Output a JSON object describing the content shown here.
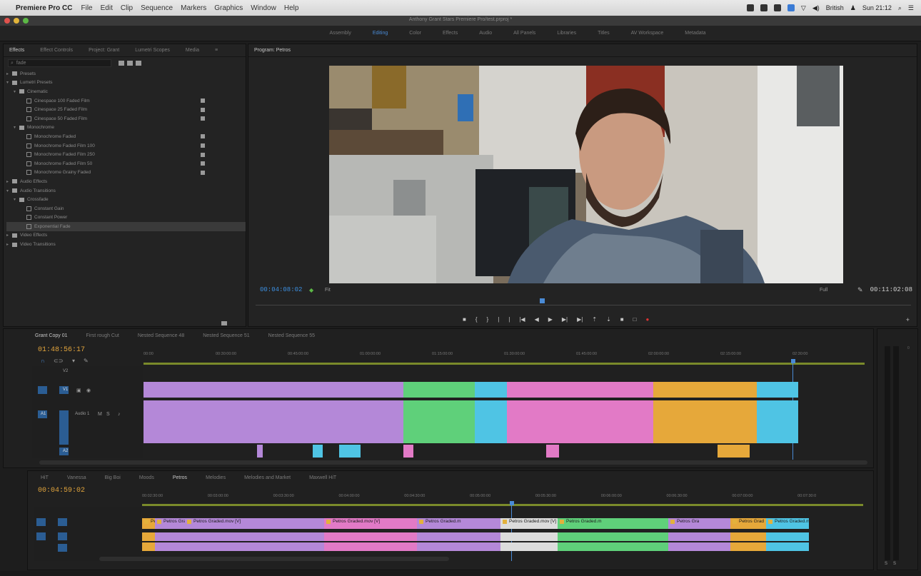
{
  "menubar": {
    "app_name": "Premiere Pro CC",
    "menus": [
      "File",
      "Edit",
      "Clip",
      "Sequence",
      "Markers",
      "Graphics",
      "Window",
      "Help"
    ],
    "language": "British",
    "clock": "Sun 21:12"
  },
  "window": {
    "title": "Anthony Grant Stars Premiere Pro/test.prproj *"
  },
  "workspaces": {
    "items": [
      "Assembly",
      "Editing",
      "Color",
      "Effects",
      "Audio",
      "All Panels",
      "Libraries",
      "Titles",
      "AV Workspace",
      "Metadata"
    ],
    "active": "Editing"
  },
  "effects_panel": {
    "tabs": [
      "Effects",
      "Effect Controls",
      "Project: Grant",
      "Lumetri Scopes",
      "Media"
    ],
    "search_value": "fade",
    "tree": [
      {
        "label": "Presets",
        "level": 0,
        "kind": "folder"
      },
      {
        "label": "Lumetri Presets",
        "level": 0,
        "kind": "folder"
      },
      {
        "label": "Cinematic",
        "level": 1,
        "kind": "folder"
      },
      {
        "label": "Cinespace 100 Faded Film",
        "level": 2,
        "kind": "fx",
        "badge": true
      },
      {
        "label": "Cinespace 25 Faded Film",
        "level": 2,
        "kind": "fx",
        "badge": true
      },
      {
        "label": "Cinespace 50 Faded Film",
        "level": 2,
        "kind": "fx",
        "badge": true
      },
      {
        "label": "Monochrome",
        "level": 1,
        "kind": "folder"
      },
      {
        "label": "Monochrome Faded",
        "level": 2,
        "kind": "fx",
        "badge": true
      },
      {
        "label": "Monochrome Faded Film 100",
        "level": 2,
        "kind": "fx",
        "badge": true
      },
      {
        "label": "Monochrome Faded Film 250",
        "level": 2,
        "kind": "fx",
        "badge": true
      },
      {
        "label": "Monochrome Faded Film 50",
        "level": 2,
        "kind": "fx",
        "badge": true
      },
      {
        "label": "Monochrome Grainy Faded",
        "level": 2,
        "kind": "fx",
        "badge": true
      },
      {
        "label": "Audio Effects",
        "level": 0,
        "kind": "folder"
      },
      {
        "label": "Audio Transitions",
        "level": 0,
        "kind": "folder"
      },
      {
        "label": "Crossfade",
        "level": 1,
        "kind": "folder"
      },
      {
        "label": "Constant Gain",
        "level": 2,
        "kind": "fx"
      },
      {
        "label": "Constant Power",
        "level": 2,
        "kind": "fx"
      },
      {
        "label": "Exponential Fade",
        "level": 2,
        "kind": "fx",
        "selected": true
      },
      {
        "label": "Video Effects",
        "level": 0,
        "kind": "folder"
      },
      {
        "label": "Video Transitions",
        "level": 0,
        "kind": "folder"
      }
    ]
  },
  "program_monitor": {
    "tab": "Program: Petros",
    "current_timecode": "00:04:08:02",
    "zoom": "Fit",
    "resolution": "Full",
    "duration": "00:11:02:08"
  },
  "timeline1": {
    "tabs": [
      "Grant Copy 01",
      "First rough Cut",
      "Nested Sequence 48",
      "Nested Sequence 51",
      "Nested Sequence 55"
    ],
    "timecode": "01:48:56:17",
    "ruler": [
      "00:00",
      "00:30:00:00",
      "00:45:00:00",
      "01:00:00:00",
      "01:15:00:00",
      "01:30:00:00",
      "01:45:00:00",
      "02:00:00:00",
      "02:15:00:00",
      "02:30:00"
    ],
    "tracks": {
      "v2": "V2",
      "v1": "V1",
      "a1": "A1",
      "audio_label": "Audio 1",
      "a2": "A2"
    }
  },
  "timeline2": {
    "tabs": [
      "HiT",
      "Vanessa",
      "Big Boi",
      "Moods",
      "Petros",
      "Melodies",
      "Melodies and Market",
      "Maxwell HiT"
    ],
    "active_tab": "Petros",
    "timecode": "00:04:59:02",
    "ruler": [
      "00:02:30:00",
      "00:03:00:00",
      "00:03:30:00",
      "00:04:00:00",
      "00:04:30:00",
      "00:05:00:00",
      "00:05:30:00",
      "00:06:00:00",
      "00:06:30:00",
      "00:07:00:00",
      "00:07:30:0"
    ],
    "clips": [
      "Petr",
      "Petros Graded.mov [V]",
      "Petros Graded.mov [V]",
      "Petros Graded.mov [V]",
      "Petros Graded.m",
      "Petros Graded.mov [V]",
      "Petros Graded.m",
      "Petros Gra",
      "Petros Grad",
      "Petros Graded.m"
    ]
  },
  "colors": {
    "accent_blue": "#4a8bd6",
    "timecode_orange": "#e0a33c",
    "clip_purple": "#b488d8",
    "clip_pink": "#e27ac6",
    "clip_green": "#5fd07a",
    "clip_orange": "#e6a83a",
    "clip_cyan": "#4fc4e4"
  }
}
